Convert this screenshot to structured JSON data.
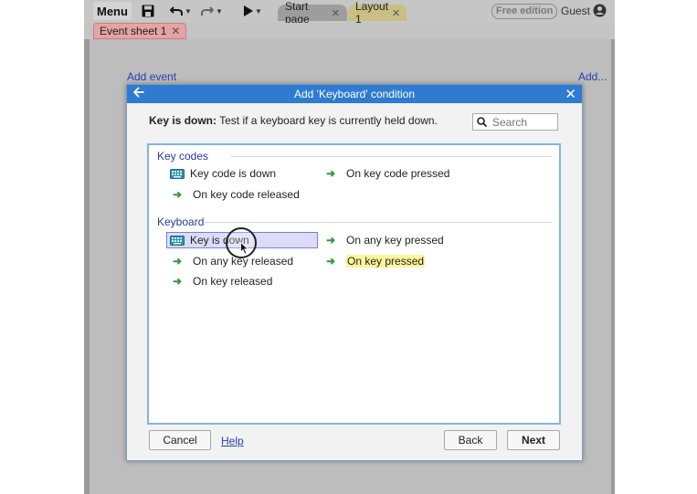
{
  "toolbar": {
    "menu_label": "Menu",
    "tabs": [
      {
        "label": "Start page"
      },
      {
        "label": "Layout 1"
      }
    ],
    "free_badge": "Free edition",
    "user_label": "Guest"
  },
  "sheet_tab": {
    "label": "Event sheet 1"
  },
  "event_sheet": {
    "add_event_label": "Add event",
    "add_label": "Add..."
  },
  "dialog": {
    "title": "Add 'Keyboard' condition",
    "description_bold": "Key is down:",
    "description_text": " Test if a keyboard key is currently held down.",
    "search_placeholder": "Search",
    "groups": [
      {
        "title": "Key codes",
        "items": [
          {
            "label": "Key code is down",
            "icon": "keyboard-icon"
          },
          {
            "label": "On key code pressed",
            "icon": "trigger-arrow-icon"
          },
          {
            "label": "On key code released",
            "icon": "trigger-arrow-icon"
          }
        ]
      },
      {
        "title": "Keyboard",
        "items": [
          {
            "label": "Key is down",
            "icon": "keyboard-icon",
            "selected": true
          },
          {
            "label": "On any key pressed",
            "icon": "trigger-arrow-icon"
          },
          {
            "label": "On any key released",
            "icon": "trigger-arrow-icon"
          },
          {
            "label": "On key pressed",
            "icon": "trigger-arrow-icon",
            "highlighted": true
          },
          {
            "label": "On key released",
            "icon": "trigger-arrow-icon"
          }
        ]
      }
    ],
    "buttons": {
      "cancel": "Cancel",
      "help": "Help",
      "back": "Back",
      "next": "Next"
    }
  },
  "colors": {
    "titlebar": "#2e7bd1",
    "selection": "#dcdcf8",
    "highlight": "#fbf59a",
    "trigger_arrow": "#2f9a3c",
    "link": "#2440b0"
  }
}
